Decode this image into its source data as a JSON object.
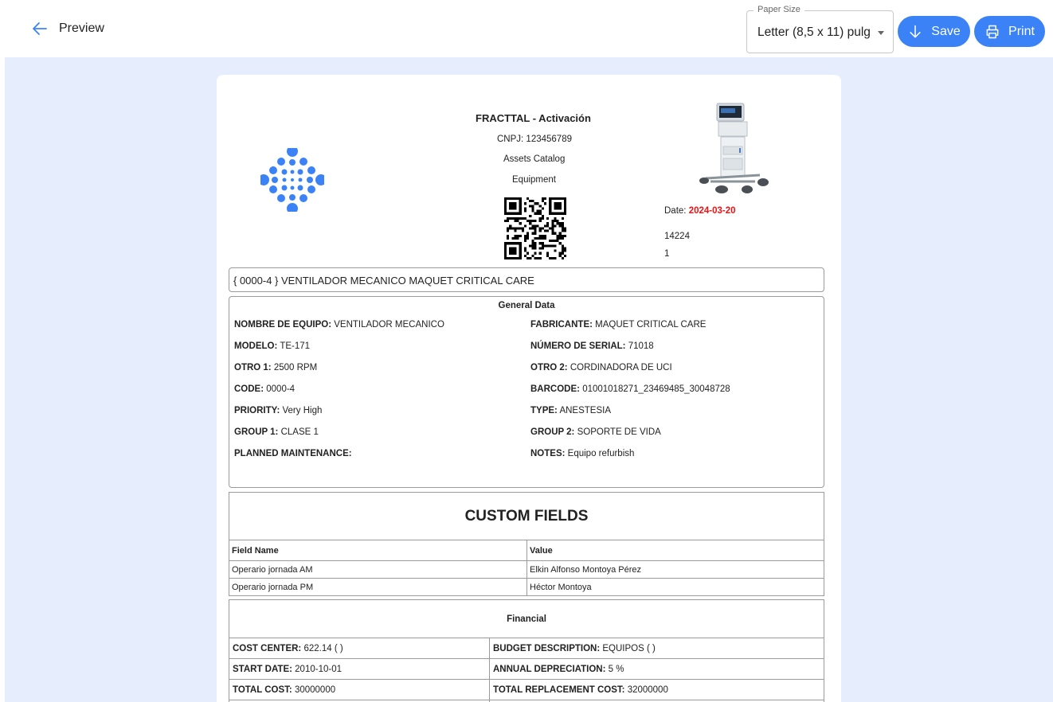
{
  "header": {
    "back_label": "Preview",
    "paper_size": {
      "legend": "Paper Size",
      "value": "Letter (8,5 x 11) pulg"
    },
    "save_label": "Save",
    "print_label": "Print"
  },
  "colors": {
    "accent": "#3b82f6",
    "canvas_bg": "#e6edfc",
    "date_red": "#e11111"
  },
  "document": {
    "company": "FRACTTAL - Activación",
    "cnpj": "CNPJ: 123456789",
    "catalog": "Assets Catalog",
    "category": "Equipment",
    "date_label": "Date:",
    "date_value": "2024-03-20",
    "meta_line1": "14224",
    "meta_line2": "1",
    "asset_title": "{ 0000-4 } VENTILADOR MECANICO MAQUET CRITICAL CARE",
    "general": {
      "heading": "General Data",
      "fields": [
        {
          "label": "NOMBRE DE EQUIPO:",
          "value": "VENTILADOR MECANICO"
        },
        {
          "label": "FABRICANTE:",
          "value": "MAQUET CRITICAL CARE"
        },
        {
          "label": "MODELO:",
          "value": "TE-171"
        },
        {
          "label": "NÚMERO DE SERIAL:",
          "value": "71018"
        },
        {
          "label": "OTRO 1:",
          "value": "2500 RPM"
        },
        {
          "label": "OTRO 2:",
          "value": "CORDINADORA DE UCI"
        },
        {
          "label": "CODE:",
          "value": "0000-4"
        },
        {
          "label": "BARCODE:",
          "value": "01001018271_23469485_30048728"
        },
        {
          "label": "PRIORITY:",
          "value": "Very High"
        },
        {
          "label": "TYPE:",
          "value": "ANESTESIA"
        },
        {
          "label": "GROUP 1:",
          "value": "CLASE 1"
        },
        {
          "label": "GROUP 2:",
          "value": "SOPORTE DE VIDA"
        },
        {
          "label": "PLANNED MAINTENANCE:",
          "value": ""
        },
        {
          "label": "NOTES:",
          "value": "Equipo refurbish"
        }
      ]
    },
    "custom_fields": {
      "heading": "CUSTOM FIELDS",
      "columns": [
        "Field Name",
        "Value"
      ],
      "rows": [
        [
          "Operario jornada AM",
          "Elkin Alfonso Montoya Pérez"
        ],
        [
          "Operario jornada PM",
          "Héctor Montoya"
        ]
      ]
    },
    "financial": {
      "heading": "Financial",
      "rows": [
        [
          {
            "label": "COST CENTER:",
            "value": "622.14 ( )"
          },
          {
            "label": "BUDGET DESCRIPTION:",
            "value": "EQUIPOS ( )"
          }
        ],
        [
          {
            "label": "START DATE:",
            "value": "2010-10-01"
          },
          {
            "label": "ANNUAL DEPRECIATION:",
            "value": "5 %"
          }
        ],
        [
          {
            "label": "TOTAL COST:",
            "value": "30000000"
          },
          {
            "label": "TOTAL REPLACEMENT COST:",
            "value": "32000000"
          }
        ]
      ]
    }
  }
}
